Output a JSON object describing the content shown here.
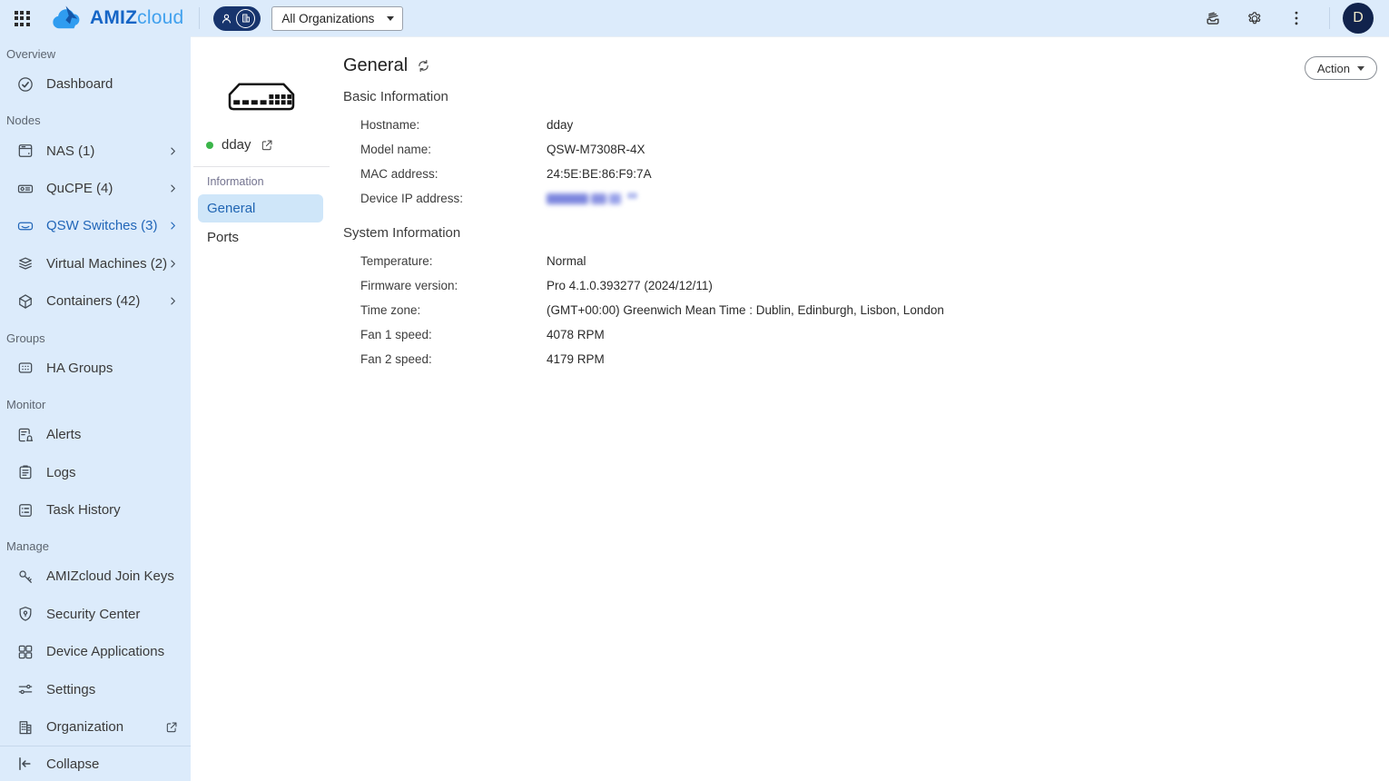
{
  "colors": {
    "topbar_bg": "#dcebfb",
    "brand_navy": "#17346d",
    "accent_blue": "#2166b8",
    "logo_dark_blue": "#1565c6",
    "logo_light_blue": "#41a1ee",
    "online_green": "#3bb54a",
    "active_nav_bg": "#cfe6f9"
  },
  "topbar": {
    "logo": {
      "bold": "AMIZ",
      "light": "cloud"
    },
    "org_selector": {
      "value": "All Organizations"
    },
    "icons": [
      "apps-grid-icon",
      "person-icon",
      "organization-icon",
      "activity-queue-icon",
      "settings-gear-icon",
      "more-vertical-icon"
    ],
    "avatar_letter": "D"
  },
  "sidebar": {
    "sections": [
      {
        "label": "Overview",
        "items": [
          {
            "label": "Dashboard",
            "icon": "dashboard-icon",
            "active": false,
            "chevron": false
          }
        ]
      },
      {
        "label": "Nodes",
        "items": [
          {
            "label": "NAS (1)",
            "icon": "nas-icon",
            "active": false,
            "chevron": true
          },
          {
            "label": "QuCPE (4)",
            "icon": "qucpe-icon",
            "active": false,
            "chevron": true
          },
          {
            "label": "QSW Switches (3)",
            "icon": "switch-icon",
            "active": true,
            "chevron": true
          },
          {
            "label": "Virtual Machines (2)",
            "icon": "virtual-machines-icon",
            "active": false,
            "chevron": true
          },
          {
            "label": "Containers (42)",
            "icon": "containers-icon",
            "active": false,
            "chevron": true
          }
        ]
      },
      {
        "label": "Groups",
        "items": [
          {
            "label": "HA Groups",
            "icon": "ha-groups-icon",
            "active": false,
            "chevron": false
          }
        ]
      },
      {
        "label": "Monitor",
        "items": [
          {
            "label": "Alerts",
            "icon": "alerts-icon",
            "active": false,
            "chevron": false
          },
          {
            "label": "Logs",
            "icon": "logs-icon",
            "active": false,
            "chevron": false
          },
          {
            "label": "Task History",
            "icon": "task-history-icon",
            "active": false,
            "chevron": false
          }
        ]
      },
      {
        "label": "Manage",
        "items": [
          {
            "label": "AMIZcloud Join Keys",
            "icon": "join-keys-icon",
            "active": false,
            "chevron": false
          },
          {
            "label": "Security Center",
            "icon": "security-center-icon",
            "active": false,
            "chevron": false
          },
          {
            "label": "Device Applications",
            "icon": "device-applications-icon",
            "active": false,
            "chevron": false
          },
          {
            "label": "Settings",
            "icon": "settings-sliders-icon",
            "active": false,
            "chevron": false
          },
          {
            "label": "Organization",
            "icon": "organization-building-icon",
            "active": false,
            "external_link": true
          }
        ]
      }
    ],
    "collapse_label": "Collapse"
  },
  "device_panel": {
    "device_name": "dday",
    "status": "online",
    "device_image": "switch-front-illustration",
    "nav_title": "Information",
    "nav_items": [
      {
        "label": "General",
        "active": true
      },
      {
        "label": "Ports",
        "active": false
      }
    ]
  },
  "main": {
    "title": "General",
    "action_button_label": "Action",
    "basic_info": {
      "title": "Basic Information",
      "rows": [
        {
          "label": "Hostname:",
          "value": "dday"
        },
        {
          "label": "Model name:",
          "value": "QSW-M7308R-4X"
        },
        {
          "label": "MAC address:",
          "value": "24:5E:BE:86:F9:7A"
        },
        {
          "label": "Device IP address:",
          "value": "",
          "redacted": true
        }
      ]
    },
    "system_info": {
      "title": "System Information",
      "rows": [
        {
          "label": "Temperature:",
          "value": "Normal"
        },
        {
          "label": "Firmware version:",
          "value": "Pro 4.1.0.393277 (2024/12/11)"
        },
        {
          "label": "Time zone:",
          "value": "(GMT+00:00) Greenwich Mean Time : Dublin, Edinburgh, Lisbon, London"
        },
        {
          "label": "Fan 1 speed:",
          "value": "4078 RPM"
        },
        {
          "label": "Fan 2 speed:",
          "value": "4179 RPM"
        }
      ]
    }
  }
}
